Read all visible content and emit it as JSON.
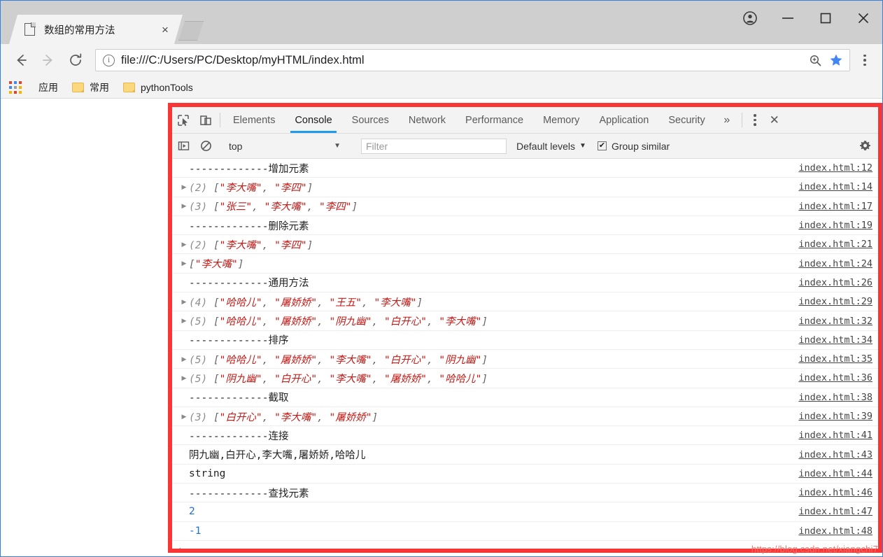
{
  "browser": {
    "tab": {
      "title": "数组的常用方法",
      "close_label": "×",
      "page_icon": "page-icon"
    },
    "window_controls": {
      "profile": "profile-icon",
      "minimize": "—",
      "maximize": "□",
      "close": "✕"
    },
    "nav": {
      "back": "←",
      "forward": "→",
      "reload": "⟳"
    },
    "omnibox": {
      "url": "file:///C:/Users/PC/Desktop/myHTML/index.html",
      "info_icon": "info-icon",
      "zoom_icon": "zoom-magnifier-icon",
      "bookmark_star": "star-filled-icon"
    },
    "bookmarks": [
      {
        "label": "应用",
        "icon": "apps-grid-icon"
      },
      {
        "label": "常用",
        "icon": "folder-icon"
      },
      {
        "label": "pythonTools",
        "icon": "folder-icon"
      }
    ]
  },
  "devtools": {
    "tabs": [
      {
        "label": "Elements",
        "active": false
      },
      {
        "label": "Console",
        "active": true
      },
      {
        "label": "Sources",
        "active": false
      },
      {
        "label": "Network",
        "active": false
      },
      {
        "label": "Performance",
        "active": false
      },
      {
        "label": "Memory",
        "active": false
      },
      {
        "label": "Application",
        "active": false
      },
      {
        "label": "Security",
        "active": false
      }
    ],
    "overflow_label": "»",
    "close_label": "✕",
    "inspect_icon": "inspect-element-icon",
    "device_icon": "device-toolbar-icon",
    "filterbar": {
      "sidebar_icon": "console-sidebar-icon",
      "clear_icon": "clear-console-icon",
      "context": "top",
      "context_caret": "▼",
      "filter_placeholder": "Filter",
      "levels_label": "Default levels",
      "levels_caret": "▼",
      "group_similar_label": "Group similar",
      "group_similar_checked": true,
      "settings_icon": "gear-icon"
    },
    "console_rows": [
      {
        "kind": "plain",
        "text": "-------------增加元素",
        "source": "index.html:12"
      },
      {
        "kind": "array",
        "count": "(2)",
        "items": [
          "李大嘴",
          "李四"
        ],
        "source": "index.html:14"
      },
      {
        "kind": "array",
        "count": "(3)",
        "items": [
          "张三",
          "李大嘴",
          "李四"
        ],
        "source": "index.html:17"
      },
      {
        "kind": "plain",
        "text": "-------------删除元素",
        "source": "index.html:19"
      },
      {
        "kind": "array",
        "count": "(2)",
        "items": [
          "李大嘴",
          "李四"
        ],
        "source": "index.html:21"
      },
      {
        "kind": "array",
        "count": "",
        "items": [
          "李大嘴"
        ],
        "source": "index.html:24"
      },
      {
        "kind": "plain",
        "text": "-------------通用方法",
        "source": "index.html:26"
      },
      {
        "kind": "array",
        "count": "(4)",
        "items": [
          "哈哈儿",
          "屠娇娇",
          "王五",
          "李大嘴"
        ],
        "source": "index.html:29"
      },
      {
        "kind": "array",
        "count": "(5)",
        "items": [
          "哈哈儿",
          "屠娇娇",
          "阴九幽",
          "白开心",
          "李大嘴"
        ],
        "source": "index.html:32"
      },
      {
        "kind": "plain",
        "text": "-------------排序",
        "source": "index.html:34"
      },
      {
        "kind": "array",
        "count": "(5)",
        "items": [
          "哈哈儿",
          "屠娇娇",
          "李大嘴",
          "白开心",
          "阴九幽"
        ],
        "source": "index.html:35"
      },
      {
        "kind": "array",
        "count": "(5)",
        "items": [
          "阴九幽",
          "白开心",
          "李大嘴",
          "屠娇娇",
          "哈哈儿"
        ],
        "source": "index.html:36"
      },
      {
        "kind": "plain",
        "text": "-------------截取",
        "source": "index.html:38"
      },
      {
        "kind": "array",
        "count": "(3)",
        "items": [
          "白开心",
          "李大嘴",
          "屠娇娇"
        ],
        "source": "index.html:39"
      },
      {
        "kind": "plain",
        "text": "-------------连接",
        "source": "index.html:41"
      },
      {
        "kind": "plain",
        "text": "阴九幽,白开心,李大嘴,屠娇娇,哈哈儿",
        "source": "index.html:43"
      },
      {
        "kind": "plain",
        "text": "string",
        "source": "index.html:44"
      },
      {
        "kind": "plain",
        "text": "-------------查找元素",
        "source": "index.html:46"
      },
      {
        "kind": "number",
        "text": "2",
        "source": "index.html:47"
      },
      {
        "kind": "number",
        "text": "-1",
        "source": "index.html:48"
      }
    ],
    "prompt_arrow": "›"
  },
  "watermark": "https://blog.csdn.net/xiangchi7",
  "colors": {
    "accent_blue": "#1f9cf0",
    "annotation_red": "#fa3535",
    "string_red": "#c41a16",
    "number_blue": "#1c6fd4",
    "star_blue": "#4285f4",
    "window_chrome": "#cfcfcf"
  }
}
